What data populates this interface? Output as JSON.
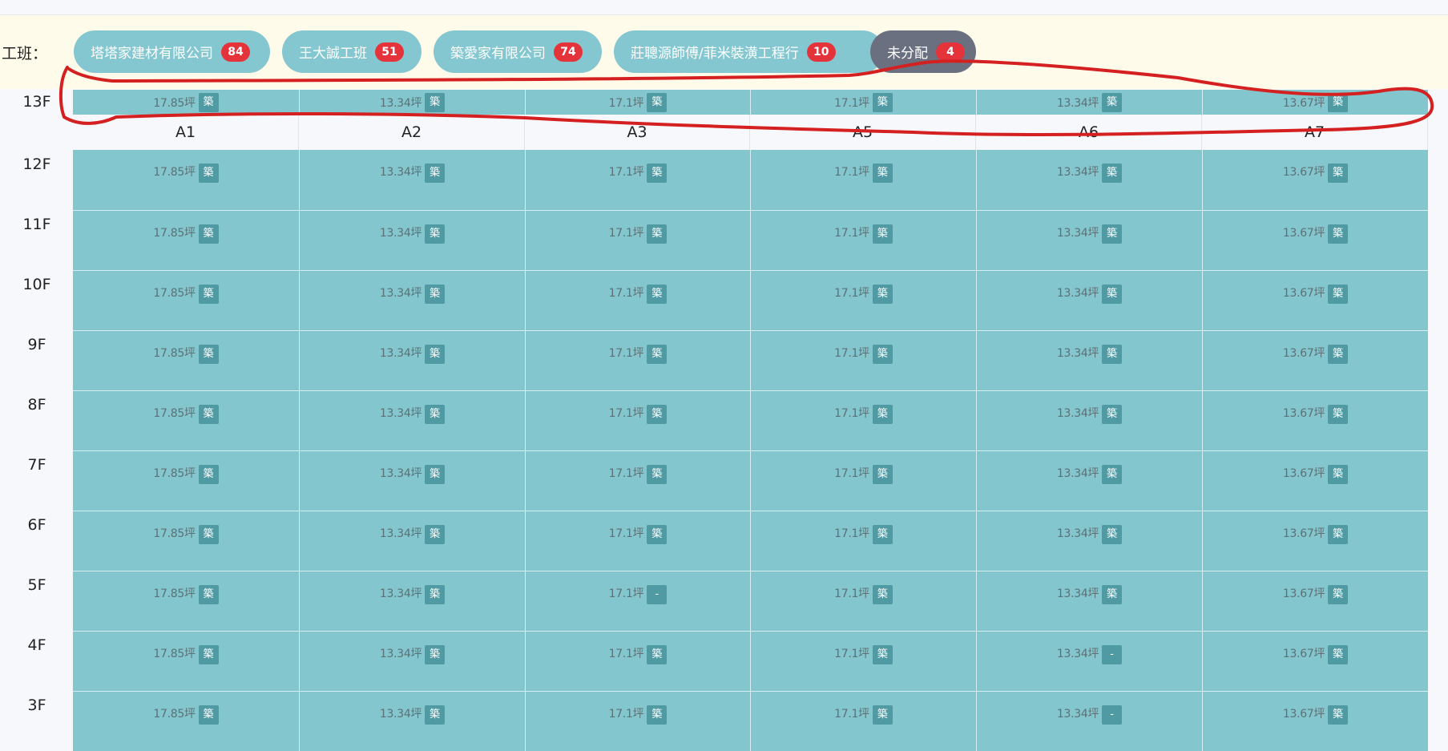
{
  "team_label": "工班：",
  "teams": [
    {
      "name": "塔塔家建材有限公司",
      "count": "84"
    },
    {
      "name": "王大誠工班",
      "count": "51"
    },
    {
      "name": "築愛家有限公司",
      "count": "74"
    },
    {
      "name": "莊聰源師傅/菲米裝潢工程行",
      "count": "10"
    },
    {
      "name": "未分配",
      "count": "4"
    }
  ],
  "columns": [
    "A1",
    "A2",
    "A3",
    "A5",
    "A6",
    "A7"
  ],
  "floors": [
    "13F",
    "12F",
    "11F",
    "10F",
    "9F",
    "8F",
    "7F",
    "6F",
    "5F",
    "4F",
    "3F"
  ],
  "sizes": [
    "17.85坪",
    "13.34坪",
    "17.1坪",
    "17.1坪",
    "13.34坪",
    "13.67坪"
  ],
  "badge_assigned": "築",
  "badge_unassigned": "-",
  "unassigned_cells": [
    {
      "floor": "5F",
      "column": "A3"
    },
    {
      "floor": "4F",
      "column": "A6"
    },
    {
      "floor": "3F",
      "column": "A6"
    }
  ],
  "annotation_color": "#d42020"
}
